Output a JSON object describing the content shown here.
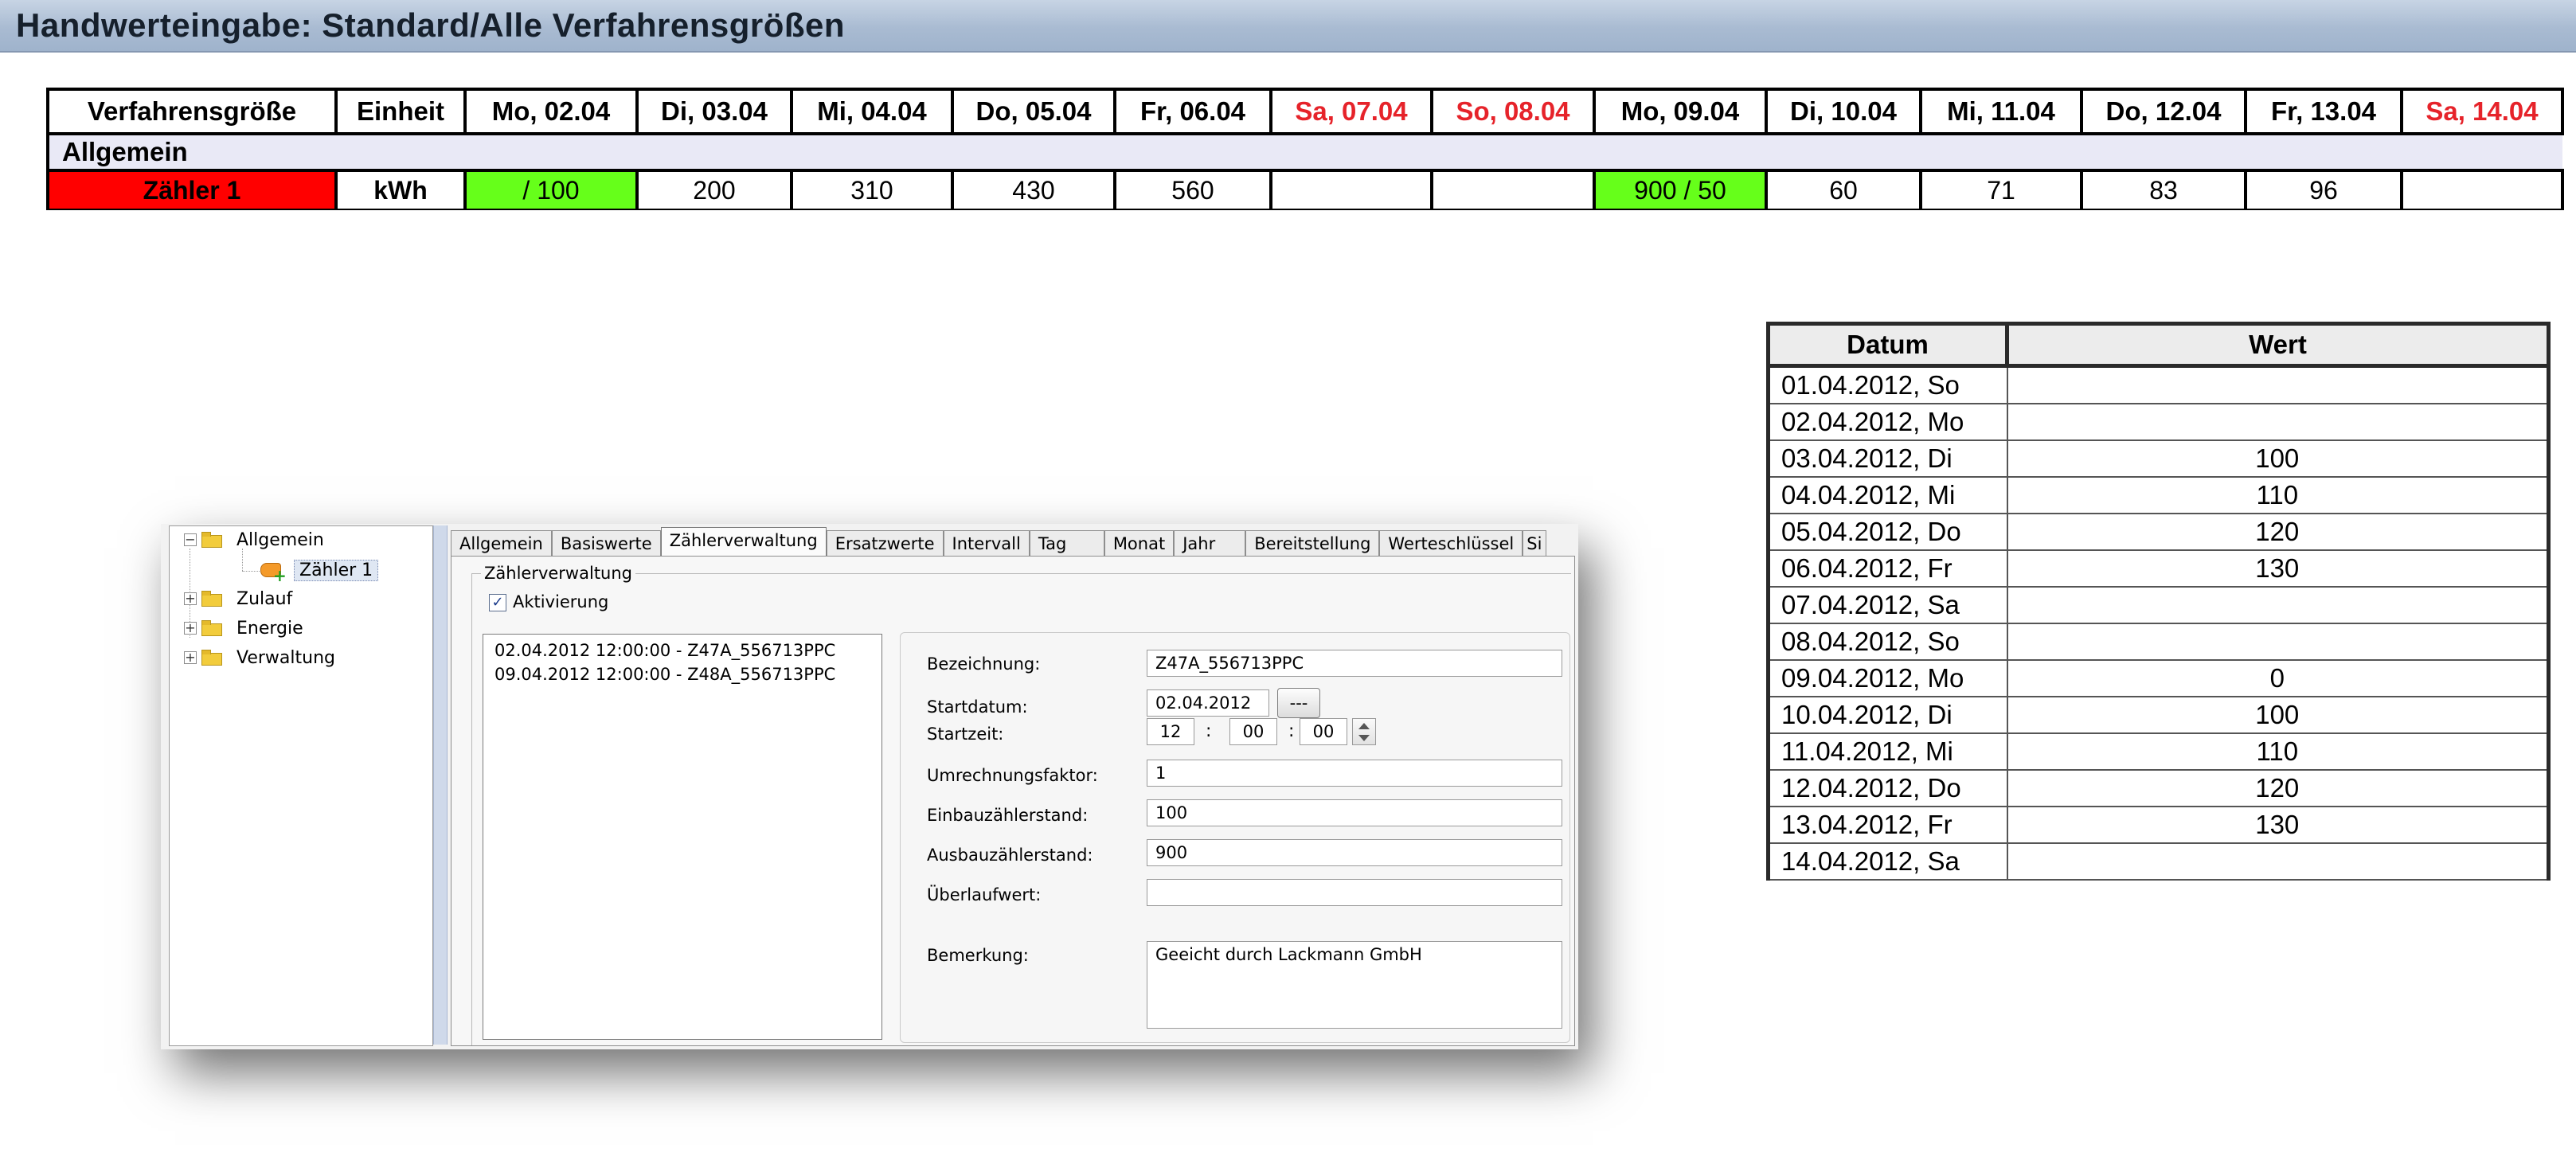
{
  "header": {
    "title": "Handwerteingabe: Standard/Alle Verfahrensgrößen"
  },
  "top_table": {
    "columns": [
      "Verfahrensgröße",
      "Einheit",
      "Mo, 02.04",
      "Di, 03.04",
      "Mi, 04.04",
      "Do, 05.04",
      "Fr, 06.04",
      "Sa, 07.04",
      "So, 08.04",
      "Mo, 09.04",
      "Di, 10.04",
      "Mi, 11.04",
      "Do, 12.04",
      "Fr, 13.04",
      "Sa, 14.04"
    ],
    "group": "Allgemein",
    "row": [
      "Zähler 1",
      "kWh",
      "/ 100",
      "200",
      "310",
      "430",
      "560",
      "",
      "",
      "900 / 50",
      "60",
      "71",
      "83",
      "96",
      ""
    ],
    "colors": {
      "weekend_header": "#e6232a",
      "name_cell": "#ff0000",
      "changed_cell": "#66ff1a",
      "group_row": "#e9e9f6"
    }
  },
  "right_table": {
    "columns": [
      "Datum",
      "Wert"
    ],
    "rows": [
      [
        "01.04.2012, So",
        ""
      ],
      [
        "02.04.2012, Mo",
        ""
      ],
      [
        "03.04.2012, Di",
        "100"
      ],
      [
        "04.04.2012, Mi",
        "110"
      ],
      [
        "05.04.2012, Do",
        "120"
      ],
      [
        "06.04.2012, Fr",
        "130"
      ],
      [
        "07.04.2012, Sa",
        ""
      ],
      [
        "08.04.2012, So",
        ""
      ],
      [
        "09.04.2012, Mo",
        "0"
      ],
      [
        "10.04.2012, Di",
        "100"
      ],
      [
        "11.04.2012, Mi",
        "110"
      ],
      [
        "12.04.2012, Do",
        "120"
      ],
      [
        "13.04.2012, Fr",
        "130"
      ],
      [
        "14.04.2012, Sa",
        ""
      ]
    ]
  },
  "dialog": {
    "tree": {
      "allgemein": "Allgemein",
      "zaehler": "Zähler 1",
      "zulauf": "Zulauf",
      "energie": "Energie",
      "verwaltung": "Verwaltung",
      "collapse_sign": "−",
      "expand_sign": "+",
      "icons": {
        "folder": "folder-icon",
        "meter": "meter-icon"
      }
    },
    "tabs": [
      "Allgemein",
      "Basiswerte",
      "Zählerverwaltung",
      "Ersatzwerte",
      "Intervall",
      "Tag",
      "Monat",
      "Jahr",
      "Bereitstellung",
      "Werteschlüssel",
      "Si"
    ],
    "active_tab": "Zählerverwaltung",
    "group_title": "Zählerverwaltung",
    "activation": {
      "label": "Aktivierung",
      "checked": true,
      "check_glyph": "✓"
    },
    "meter_list": [
      "02.04.2012 12:00:00 - Z47A_556713PPC",
      "09.04.2012 12:00:00 - Z48A_556713PPC"
    ],
    "fields": {
      "bezeichnung": {
        "label": "Bezeichnung:",
        "value": "Z47A_556713PPC"
      },
      "startdatum": {
        "label": "Startdatum:",
        "value": "02.04.2012",
        "button": "---"
      },
      "startzeit": {
        "label": "Startzeit:",
        "hour": "12",
        "minute": "00",
        "second": "00",
        "sep": ":"
      },
      "umrechnungsfaktor": {
        "label": "Umrechnungsfaktor:",
        "value": "1"
      },
      "einbau": {
        "label": "Einbauzählerstand:",
        "value": "100"
      },
      "ausbau": {
        "label": "Ausbauzählerstand:",
        "value": "900"
      },
      "ueberlauf": {
        "label": "Überlaufwert:",
        "value": ""
      },
      "bemerkung": {
        "label": "Bemerkung:",
        "value": "Geeicht durch Lackmann GmbH"
      }
    }
  }
}
